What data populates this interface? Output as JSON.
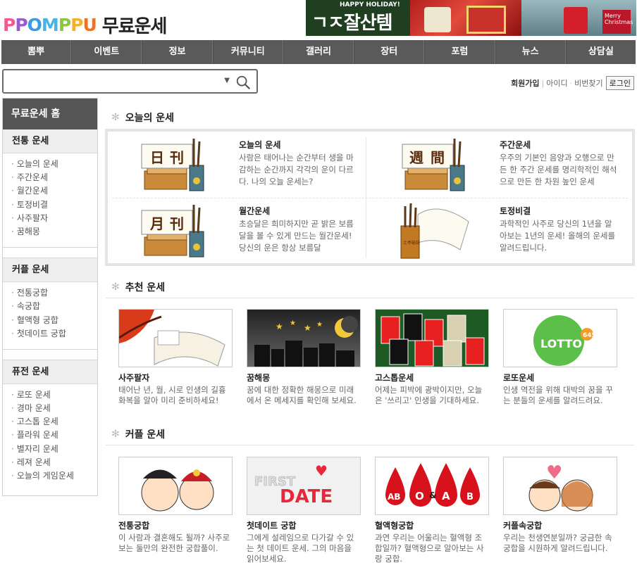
{
  "logo": {
    "letters": [
      "P",
      "P",
      "O",
      "M",
      "P",
      "P",
      "U"
    ],
    "colors": [
      "#f05a8c",
      "#9b59d0",
      "#3a9be0",
      "#44b5e6",
      "#8dc63f",
      "#f3b12b",
      "#f37021"
    ],
    "title": "무료운세"
  },
  "banner": {
    "small": "HAPPY HOLIDAY!",
    "big": "ㄱㅈ잘산템",
    "side_text": "Merry Christmas"
  },
  "nav": [
    "뽐뿌",
    "이벤트",
    "정보",
    "커뮤니티",
    "갤러리",
    "장터",
    "포럼",
    "뉴스",
    "상담실"
  ],
  "search": {
    "value": "",
    "placeholder": ""
  },
  "login": {
    "join": "회원가입",
    "id": "아이디",
    "pw": "비번찾기",
    "button": "로그인"
  },
  "sidebar": {
    "home": "무료운세 홈",
    "sections": [
      {
        "title": "전통 운세",
        "items": [
          "오늘의 운세",
          "주간운세",
          "월간운세",
          "토정비결",
          "사주팔자",
          "꿈해몽"
        ]
      },
      {
        "title": "커플 운세",
        "items": [
          "전통궁합",
          "속궁합",
          "혈액형 궁합",
          "첫데이트 궁합"
        ]
      },
      {
        "title": "퓨전 운세",
        "items": [
          "로또 운세",
          "경마 운세",
          "고스톱 운세",
          "플라워 운세",
          "별자리 운세",
          "레져 운세",
          "오늘의 게임운세"
        ]
      }
    ]
  },
  "sections": {
    "today": "오늘의 운세",
    "recommended": "추천 운세",
    "couple": "커플 운세"
  },
  "today_items": [
    {
      "title": "오늘의 운세",
      "desc": "사람은 태어나는 순간부터 생을 마감하는 순간까지 각각의 운이 다르다. 나의 오늘 운세는?",
      "hanja": [
        "日",
        "刊"
      ]
    },
    {
      "title": "주간운세",
      "desc": "우주의 기본인 음양과 오행으로 만든 한 주간 운세를 명리학적인 해석으로 만든 한 차원 높인 운세",
      "hanja": [
        "週",
        "間"
      ]
    },
    {
      "title": "월간운세",
      "desc": "초승달은 희미하지만 곧 밝은 보름달을 볼 수 있게 만드는 월간운세! 당신의 운은 항상 보름달",
      "hanja": [
        "月",
        "刊"
      ]
    },
    {
      "title": "토정비결",
      "desc": "과학적인 사주로 당신의 1년을 알아보는 1년의 운세! 올해의 운세를 알려드립니다.",
      "hanja": [
        "土亭秘訣"
      ]
    }
  ],
  "recommended": [
    {
      "name": "사주팔자",
      "desc": "태어난 년, 월, 시로 인생의 길흉화복을 알아 미리 준비하세요!"
    },
    {
      "name": "꿈해몽",
      "desc": "꿈에 대한 정확한 해몽으로 미래에서 온 메세지를 확인해 보세요."
    },
    {
      "name": "고스톱운세",
      "desc": "어제는 피박에 광박이지만, 오늘은 '쓰리고' 인생을 기대하세요."
    },
    {
      "name": "로또운세",
      "desc": "인생 역전을 위해 대박의 꿈을 꾸는 분들의 운세를 알려드려요.",
      "lotto": "LOTTO",
      "num": "645"
    }
  ],
  "couple": [
    {
      "name": "전통궁합",
      "desc": "이 사람과 결혼해도 될까? 사주로 보는 둘만의 완전한 궁합풀이."
    },
    {
      "name": "첫데이트 궁합",
      "desc": "그에게 설레임으로 다가갈 수 있는 첫 데이트 운세. 그의 마음을 읽어보세요.",
      "first": "FIRST",
      "date": "DATE"
    },
    {
      "name": "혈액형궁합",
      "desc": "과연 우리는 어울리는 혈액형 조합일까? 혈액형으로 알아보는 사랑 궁합.",
      "blood": [
        "AB",
        "O",
        "&",
        "A",
        "B"
      ]
    },
    {
      "name": "커플속궁합",
      "desc": "우리는 천생연분일까? 궁금한 속궁합을 시원하게 알려드립니다."
    }
  ]
}
